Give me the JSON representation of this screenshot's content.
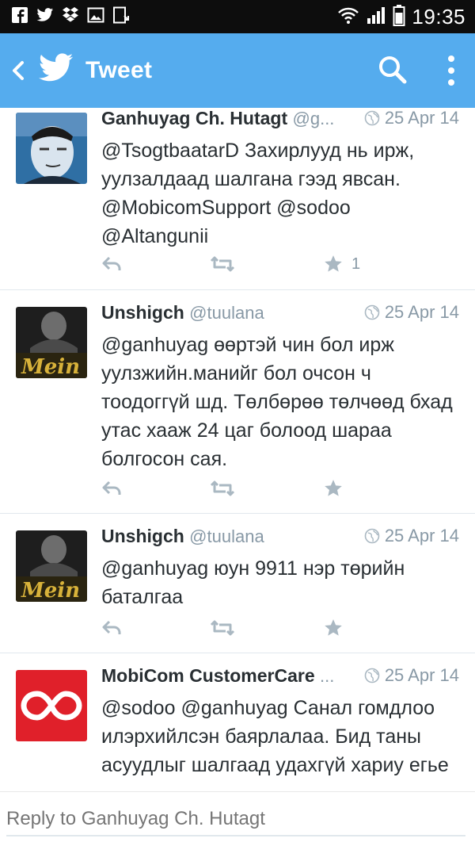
{
  "status_bar": {
    "time": "19:35",
    "left_icons": [
      "facebook-icon",
      "twitter-icon",
      "dropbox-icon",
      "gallery-icon",
      "download-icon"
    ],
    "right_icons": [
      "wifi-icon",
      "signal-icon",
      "battery-icon"
    ]
  },
  "app_bar": {
    "title": "Tweet",
    "background": "#55acee",
    "icons": [
      "back-icon",
      "twitter-bird-icon",
      "search-icon",
      "overflow-menu-icon"
    ]
  },
  "tweets": [
    {
      "name": "Ganhuyag Ch. Hutagt",
      "handle": "@g...",
      "date": "25 Apr 14",
      "text": "@TsogtbaatarD Захирлууд нь ирж, уулзалдаад шалгана гээд явсан. @MobicomSupport @sodoo @Altangunii",
      "favorite_count": "1"
    },
    {
      "name": "Unshigch",
      "handle": "@tuulana",
      "date": "25 Apr 14",
      "text": "@ganhuyag өөртэй чин бол ирж уулзжийн.манийг бол очсон ч тоодоггүй шд. Төлбөрөө төлчөөд бхад утас хааж 24 цаг болоод шараа болгосон сая.",
      "favorite_count": ""
    },
    {
      "name": "Unshigch",
      "handle": "@tuulana",
      "date": "25 Apr 14",
      "text": "@ganhuyag юун 9911 нэр төрийн баталгаа",
      "favorite_count": ""
    },
    {
      "name": "MobiCom CustomerCare",
      "handle": "...",
      "date": "25 Apr 14",
      "text": "@sodoo @ganhuyag Санал гомдлоо илэрхийлсэн баярлалаа. Бид таны асуудлыг шалгаад удахгүй хариу егье",
      "favorite_count": ""
    }
  ],
  "avatar_texts": {
    "mein": "Mein"
  },
  "reply": {
    "placeholder": "Reply to Ganhuyag Ch. Hutagt"
  },
  "colors": {
    "accent": "#55acee",
    "text": "#292f33",
    "muted": "#8899a6",
    "action_icon": "#aab8c2",
    "mobicom_red": "#e0202a"
  }
}
